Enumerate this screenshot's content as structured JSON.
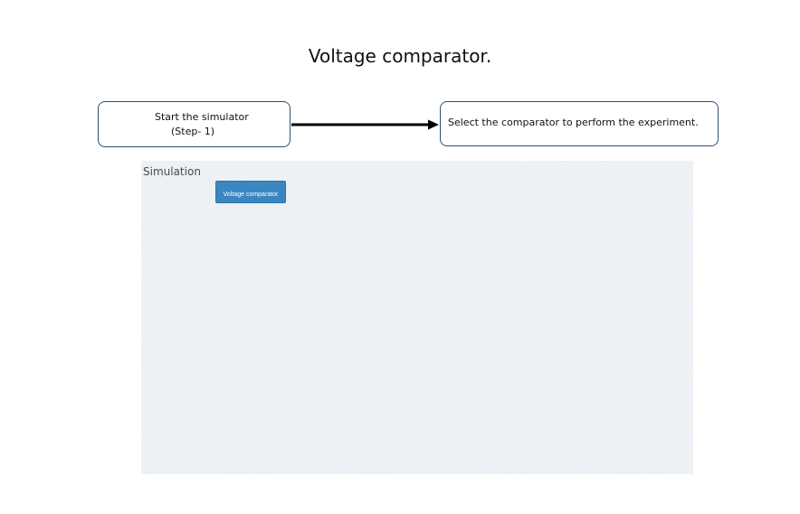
{
  "page": {
    "title": "Voltage comparator."
  },
  "steps": {
    "step1_line1": "Start the simulator",
    "step1_line2": "(Step- 1)",
    "instruction": "Select the comparator to perform the experiment."
  },
  "simulation": {
    "label": "Simulation",
    "button_label": "Voltage comparator"
  },
  "colors": {
    "box_border": "#2d4e72",
    "arrow": "#000000",
    "panel_background": "#eef2f6",
    "button_background": "#3a86c1"
  },
  "icons": {
    "connector": "arrow-right-icon"
  }
}
